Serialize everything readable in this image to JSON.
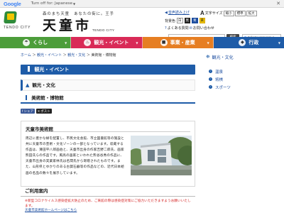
{
  "google_translate": {
    "brand": "Google",
    "options_label": "Turn off for: Japanese",
    "close": "✕"
  },
  "header": {
    "catchphrase": "森のまち天童　あなたの街に。王手",
    "city_name": "天童市",
    "city_name_en": "TENDO CITY",
    "logo_text": "TENDO CITY",
    "utility": {
      "audio_label": "音声読み上げ",
      "font_size_label": "文字サイズ",
      "font_options": [
        "縮小",
        "標準",
        "拡大"
      ],
      "bg_color_label": "背景色",
      "bg_options": [
        "白",
        "黒",
        "青",
        "黄"
      ],
      "faq_label": "よくある質問",
      "inquiry_label": "お問い合わせ"
    },
    "search": {
      "placeholder": "Google 検索",
      "button": "検索"
    },
    "language_select": "Select Language"
  },
  "nav": {
    "items": [
      {
        "label": "くらし",
        "icon": "☂"
      },
      {
        "label": "観光・イベント",
        "icon": "♨"
      },
      {
        "label": "事業・産業",
        "icon": "■"
      },
      {
        "label": "行政",
        "icon": "◆"
      }
    ]
  },
  "breadcrumb": {
    "items": [
      "ホーム",
      "観光・イベント",
      "観光・文化"
    ],
    "current": "美術館・博物館",
    "separator": "＞"
  },
  "section_banner": "観光・イベント",
  "sub_banner": "観光・文化",
  "page_title": "美術館・博物館",
  "share": {
    "facebook": "f シェア",
    "x": "X ポスト"
  },
  "content": {
    "heading": "天童市美術館",
    "text": "周辺に豊かな緑を配置し、市民文化会館、市立図書館等の施設と共に天童市の芸術・文化ゾーンの一部となっています。収蔵する作品は、薄田平八郎画伯と、天童市出身の作家吉野二郎氏、画家熊田氏らの作品です。風高の画家といわれた熊谷谷秀の作品に、天童市出身の実業家林氏は名間氏から寄贈されたものです。また、山形県とゆかりのある古賀石鹸等の作品などの、近代日本絵画の名品の数々を展示しています。",
    "photo_alt": "天童市美術館 外観"
  },
  "usage": {
    "title": "ご利用案内",
    "notice": "※新型コロナウイルス感染症拡大防止のため、ご来館の際は感染症対策にご協力いただきますようお願いいたします。",
    "link": "天童市美術館ホームページはこちら"
  },
  "sidebar": {
    "heading": "観光・文化",
    "items": [
      "温泉",
      "将棋",
      "スポーツ"
    ]
  },
  "colors": {
    "kurashi": "#4c9d3a",
    "kanko": "#d92a57",
    "jigyo": "#e67e22",
    "gyosei": "#1e5ca8",
    "accent_blue": "#1e5ca8",
    "notice_red": "#d42020"
  }
}
